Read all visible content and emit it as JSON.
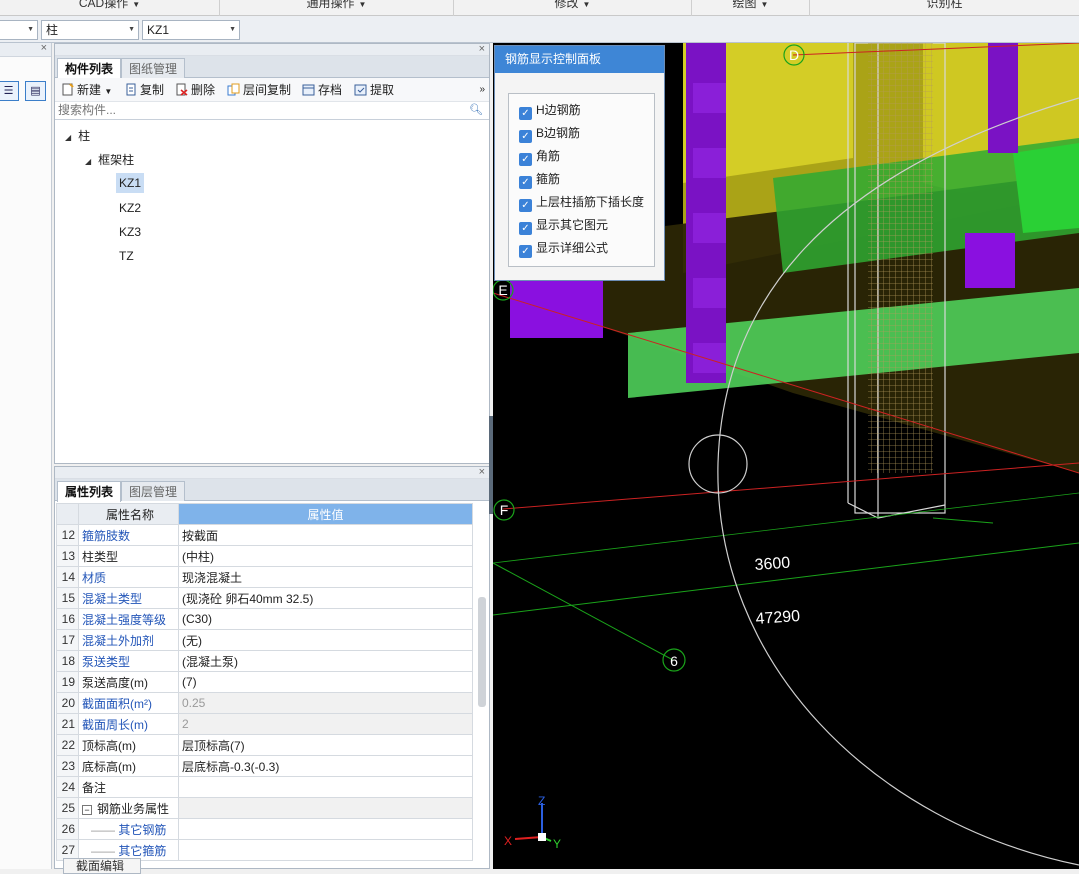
{
  "ribbon": {
    "groups": [
      "CAD操作",
      "通用操作",
      "修改",
      "绘图",
      "识别柱"
    ]
  },
  "toolbar": {
    "combo1_value": "",
    "combo2_value": "柱",
    "combo3_value": "KZ1"
  },
  "component_panel": {
    "tabs": [
      "构件列表",
      "图纸管理"
    ],
    "buttons": [
      "新建",
      "复制",
      "删除",
      "层间复制",
      "存档",
      "提取"
    ],
    "search_placeholder": "搜索构件...",
    "tree": {
      "root": "柱",
      "child": "框架柱",
      "items": [
        "KZ1",
        "KZ2",
        "KZ3",
        "TZ"
      ],
      "selected": "KZ1"
    }
  },
  "property_panel": {
    "tabs": [
      "属性列表",
      "图层管理"
    ],
    "headers": [
      "属性名称",
      "属性值"
    ],
    "rows": [
      {
        "idx": "12",
        "name": "箍筋肢数",
        "value": "按截面",
        "blue": true,
        "gray": false
      },
      {
        "idx": "13",
        "name": "柱类型",
        "value": "(中柱)",
        "blue": false,
        "gray": false
      },
      {
        "idx": "14",
        "name": "材质",
        "value": "现浇混凝土",
        "blue": true,
        "gray": false
      },
      {
        "idx": "15",
        "name": "混凝土类型",
        "value": "(现浇砼 卵石40mm 32.5)",
        "blue": true,
        "gray": false
      },
      {
        "idx": "16",
        "name": "混凝土强度等级",
        "value": "(C30)",
        "blue": true,
        "gray": false
      },
      {
        "idx": "17",
        "name": "混凝土外加剂",
        "value": "(无)",
        "blue": true,
        "gray": false
      },
      {
        "idx": "18",
        "name": "泵送类型",
        "value": "(混凝土泵)",
        "blue": true,
        "gray": false
      },
      {
        "idx": "19",
        "name": "泵送高度(m)",
        "value": "(7)",
        "blue": false,
        "gray": false
      },
      {
        "idx": "20",
        "name": "截面面积(m²)",
        "value": "0.25",
        "blue": true,
        "gray": true
      },
      {
        "idx": "21",
        "name": "截面周长(m)",
        "value": "2",
        "blue": true,
        "gray": true
      },
      {
        "idx": "22",
        "name": "顶标高(m)",
        "value": "层顶标高(7)",
        "blue": false,
        "gray": false
      },
      {
        "idx": "23",
        "name": "底标高(m)",
        "value": "层底标高-0.3(-0.3)",
        "blue": false,
        "gray": false
      },
      {
        "idx": "24",
        "name": "备注",
        "value": "",
        "blue": false,
        "gray": false
      },
      {
        "idx": "25",
        "name": "钢筋业务属性",
        "value": "",
        "blue": false,
        "gray": true,
        "group": true
      },
      {
        "idx": "26",
        "name": "其它钢筋",
        "value": "",
        "blue": true,
        "gray": false,
        "indent": true
      },
      {
        "idx": "27",
        "name": "其它箍筋",
        "value": "",
        "blue": true,
        "gray": false,
        "indent": true
      }
    ],
    "bottom_tab": "截面编辑"
  },
  "rebar_panel": {
    "title": "钢筋显示控制面板",
    "options": [
      {
        "label": "H边钢筋",
        "checked": true
      },
      {
        "label": "B边钢筋",
        "checked": true
      },
      {
        "label": "角筋",
        "checked": true
      },
      {
        "label": "箍筋",
        "checked": true
      },
      {
        "label": "上层柱插筋下插长度",
        "checked": true
      },
      {
        "label": "显示其它图元",
        "checked": true
      },
      {
        "label": "显示详细公式",
        "checked": true
      }
    ]
  },
  "viewport": {
    "axis_labels": [
      "D",
      "E",
      "F",
      "6"
    ],
    "dimensions": [
      "3600",
      "47290"
    ],
    "axes": [
      "X",
      "Y",
      "Z"
    ],
    "colors": {
      "column": "#7d16c9",
      "slab": "#c7c11c",
      "beam": "#3fcf57",
      "grid_red": "#cc2222",
      "grid_green": "#1aa31a"
    }
  }
}
